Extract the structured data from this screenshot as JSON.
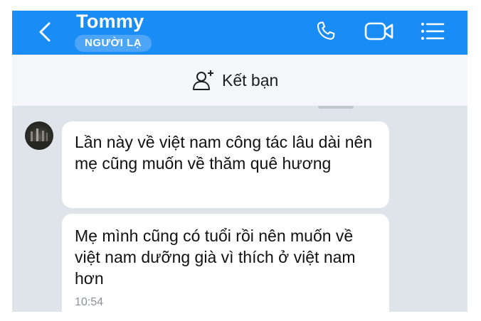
{
  "header": {
    "title": "Tommy",
    "badge": "NGƯỜI LẠ",
    "colors": {
      "bar": "#1a8cf5",
      "text": "#ffffff"
    },
    "icons": [
      "back-icon",
      "phone-icon",
      "video-call-icon",
      "menu-icon"
    ]
  },
  "friend_bar": {
    "label": "Kết bạn",
    "icon": "add-friend-icon"
  },
  "messages": [
    {
      "text": "Lần này về việt nam công tác lâu dài nên mẹ cũng muốn về thăm quê hương"
    },
    {
      "text": "Mẹ mình cũng có tuổi rồi nên muốn về việt nam dưỡng già vì thích ở việt nam hơn",
      "time": "10:54"
    }
  ]
}
